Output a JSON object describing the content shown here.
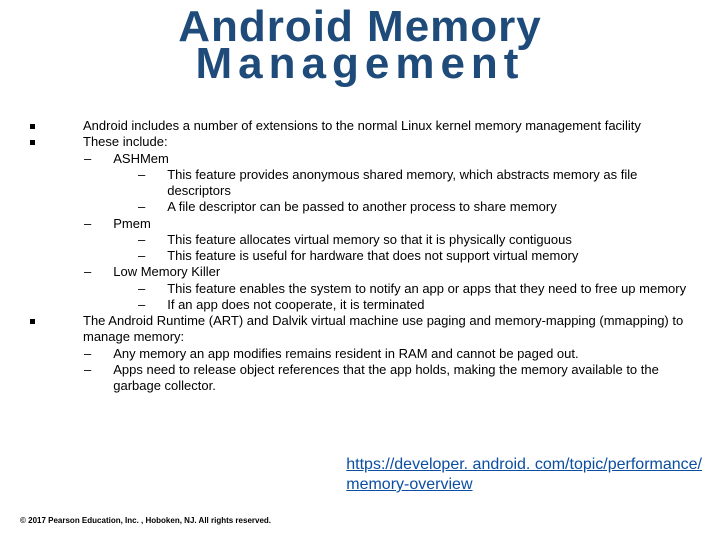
{
  "title": {
    "line1": "Android Memory",
    "line2": "Management"
  },
  "b1": "Android includes a number of extensions to the normal Linux kernel memory management facility",
  "b2": "These include:",
  "s1": "ASHMem",
  "s1a": "This feature provides anonymous shared memory, which abstracts memory as file descriptors",
  "s1b": "A file descriptor can be passed to another process to share memory",
  "s2": "Pmem",
  "s2a": "This feature allocates virtual memory so that it is physically contiguous",
  "s2b": "This feature is useful for hardware that does not support virtual memory",
  "s3": "Low Memory Killer",
  "s3a": "This feature enables the system to notify an app or apps that they need to free up memory",
  "s3b": "If an app does not cooperate, it is terminated",
  "b3": "The Android Runtime (ART) and Dalvik virtual machine use paging and memory-mapping (mmapping) to manage memory:",
  "b3a": "Any memory an app modifies remains resident in RAM and cannot be paged out.",
  "b3b": "Apps need to release object references that the app holds, making the memory available to the garbage collector.",
  "link": {
    "l1": "https://developer. android. com/topic/performance/",
    "l2": "memory-overview"
  },
  "copyright": "© 2017 Pearson Education, Inc. , Hoboken, NJ.  All rights reserved."
}
